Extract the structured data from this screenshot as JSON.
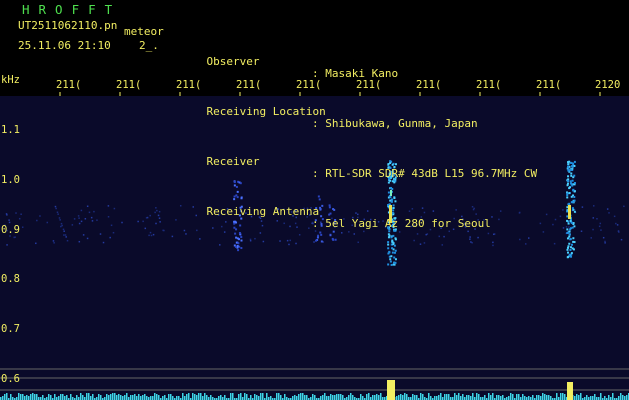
{
  "header": {
    "app_name": "HROFFT",
    "file_name": "UT2511062110.pn",
    "type": "meteor",
    "datetime": "25.11.06 21:10",
    "page": "2_.",
    "info": [
      {
        "key": "Observer",
        "value": ": Masaki Kano"
      },
      {
        "key": "Receiving Location",
        "value": ": Shibukawa, Gunma, Japan"
      },
      {
        "key": "Receiver",
        "value": ": RTL-SDR SDR# 43dB L15 96.7MHz CW"
      },
      {
        "key": "Receiving Antenna",
        "value": ": 5el Yagi Az 280 for Seoul"
      }
    ]
  },
  "spectrogram": {
    "y_unit": "kHz",
    "y_ticks": [
      "1.1",
      "1.0",
      "0.9",
      "0.8",
      "0.7",
      "0.6"
    ],
    "x_ticks": [
      "211(",
      "211(",
      "211(",
      "211(",
      "211(",
      "211(",
      "211(",
      "211(",
      "211(",
      "2120"
    ],
    "colors": {
      "background": "#0a0a2a",
      "grid": "#555555",
      "text": "#f2ee62",
      "accent": "#4ee04e"
    }
  }
}
